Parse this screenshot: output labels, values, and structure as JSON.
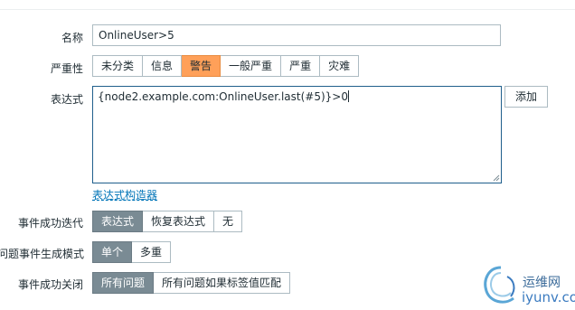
{
  "form": {
    "name_label": "名称",
    "name_value": "OnlineUser>5",
    "severity_label": "严重性",
    "severity_options": [
      "未分类",
      "信息",
      "警告",
      "一般严重",
      "严重",
      "灾难"
    ],
    "severity_selected": "警告",
    "expression_label": "表达式",
    "expression_value": "{node2.example.com:OnlineUser.last(#5)}>0",
    "add_button": "添加",
    "expression_builder_link": "表达式构造器",
    "ok_event_gen_label": "事件成功迭代",
    "ok_event_gen_options": [
      "表达式",
      "恢复表达式",
      "无"
    ],
    "ok_event_gen_selected": "表达式",
    "problem_mode_label": "问题事件生成模式",
    "problem_mode_options": [
      "单个",
      "多重"
    ],
    "problem_mode_selected": "单个",
    "ok_close_label": "事件成功关闭",
    "ok_close_options": [
      "所有问题",
      "所有问题如果标签值匹配"
    ],
    "ok_close_selected": "所有问题"
  },
  "watermark": {
    "site_name": "运维网",
    "url": "iyunv.com",
    "icon": "swirl-logo-icon"
  },
  "colors": {
    "severity_selected": "#ffa059",
    "segment_selected": "#7a8b94",
    "link": "#0275b8",
    "focus_border": "#1f5f8c"
  }
}
